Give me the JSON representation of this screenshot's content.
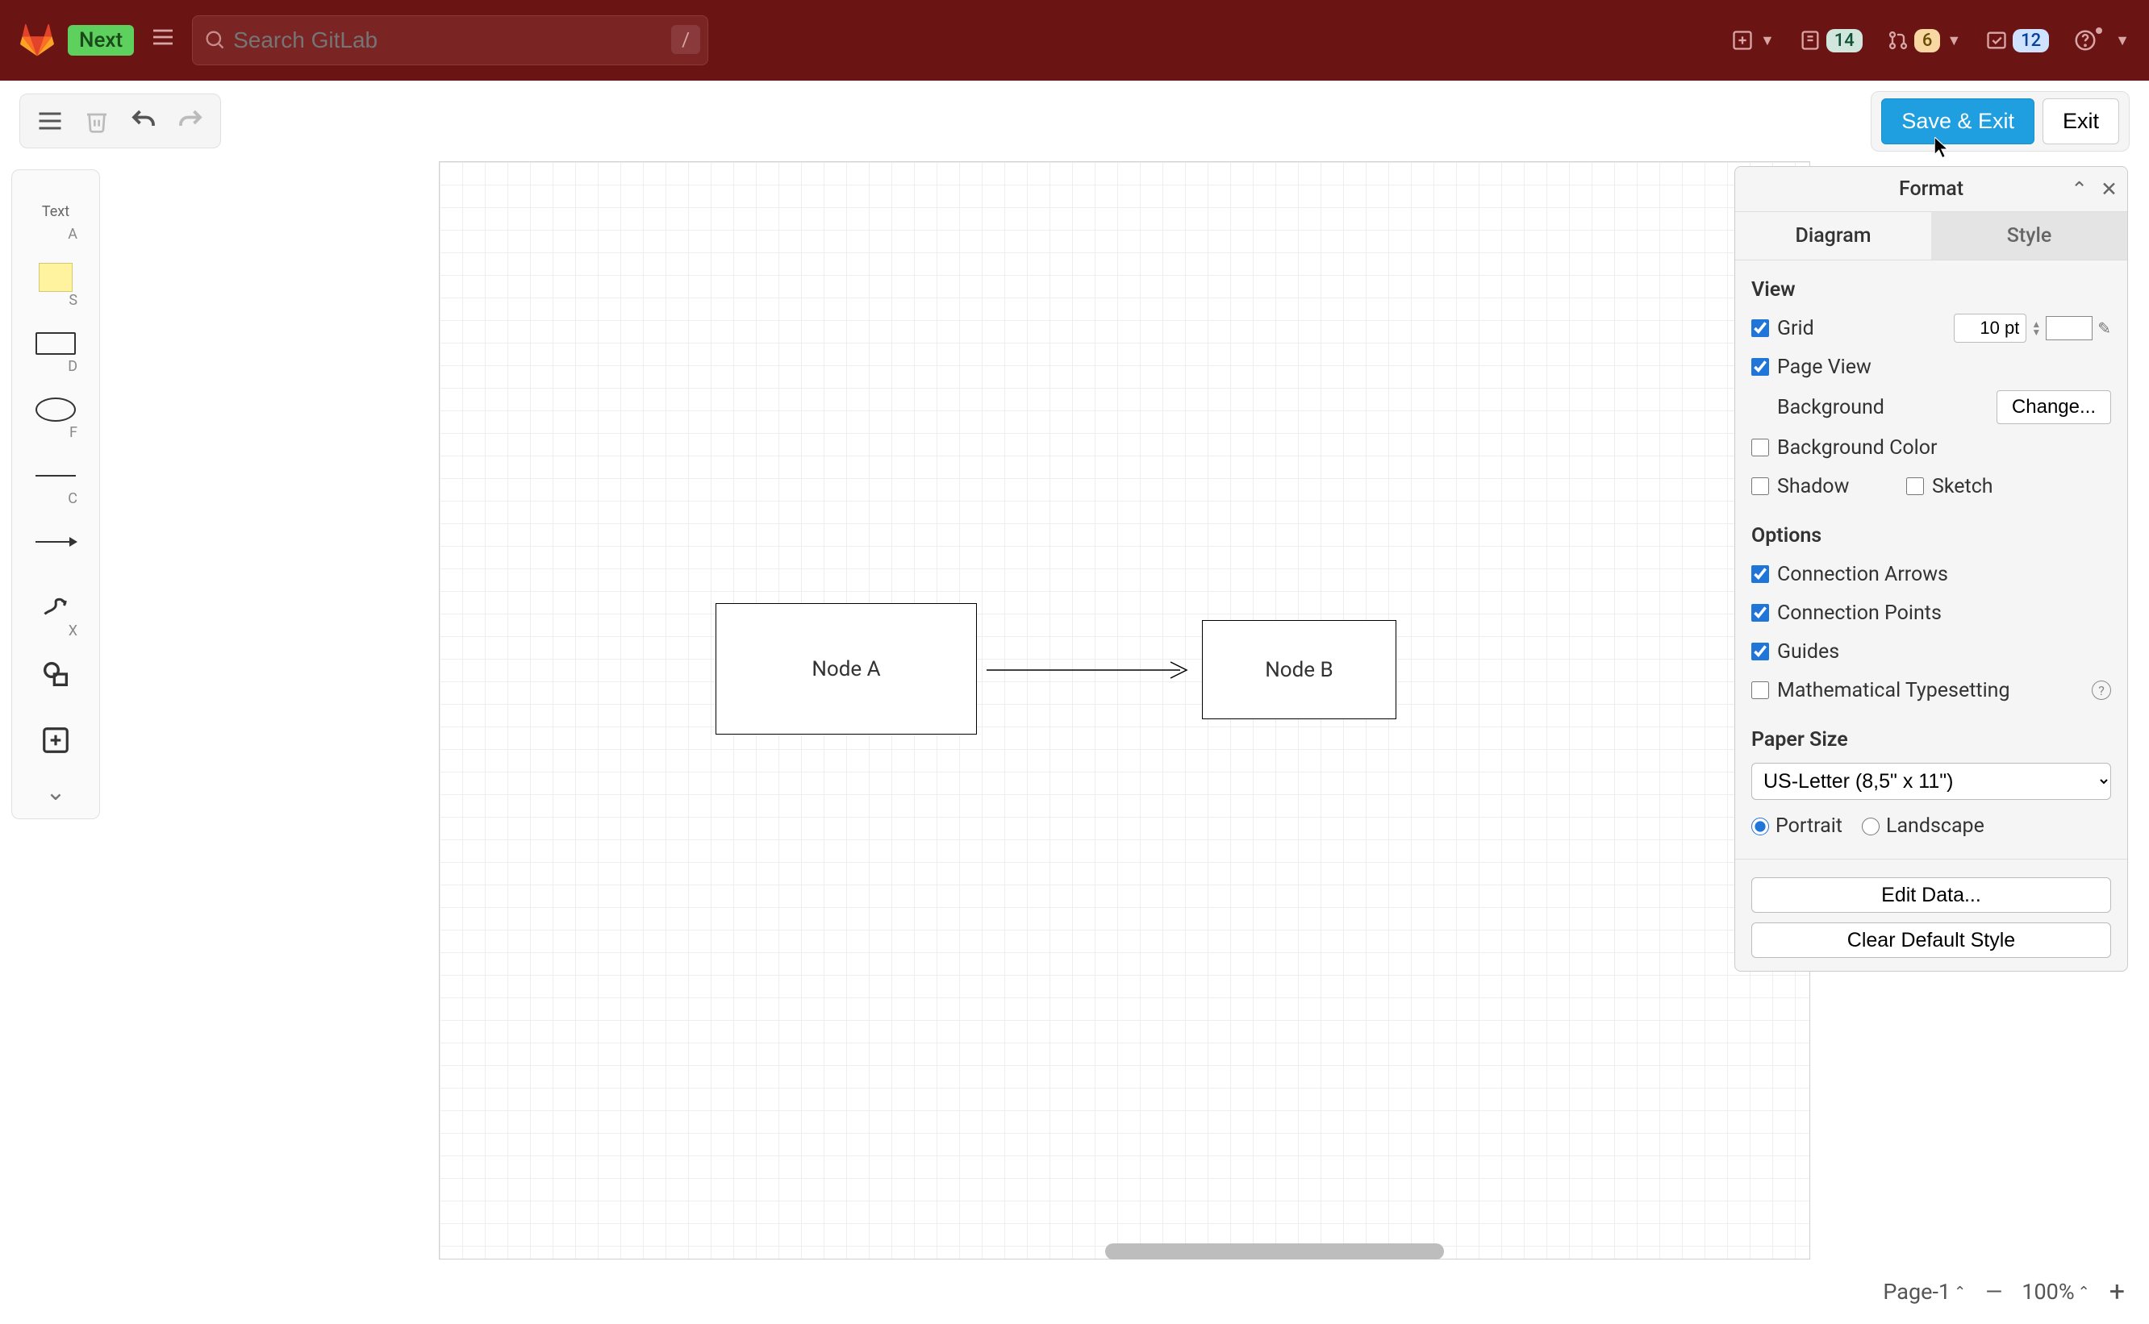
{
  "gitlab": {
    "next_label": "Next",
    "search_placeholder": "Search GitLab",
    "search_shortcut": "/",
    "badges": {
      "issues": "14",
      "merge": "6",
      "todos": "12"
    }
  },
  "toolbar": {
    "save_exit": "Save & Exit",
    "exit": "Exit"
  },
  "palette": {
    "text_label": "Text",
    "key_text": "A",
    "key_note": "S",
    "key_rect": "D",
    "key_ellipse": "F",
    "key_line": "C",
    "key_freehand": "X"
  },
  "diagram": {
    "nodes": {
      "a": {
        "label": "Node A"
      },
      "b": {
        "label": "Node B"
      }
    }
  },
  "format": {
    "title": "Format",
    "tabs": {
      "diagram": "Diagram",
      "style": "Style"
    },
    "view": {
      "title": "View",
      "grid": "Grid",
      "grid_value": "10 pt",
      "page_view": "Page View",
      "background": "Background",
      "change": "Change...",
      "background_color": "Background Color",
      "shadow": "Shadow",
      "sketch": "Sketch"
    },
    "options": {
      "title": "Options",
      "connection_arrows": "Connection Arrows",
      "connection_points": "Connection Points",
      "guides": "Guides",
      "math": "Mathematical Typesetting"
    },
    "paper": {
      "title": "Paper Size",
      "size": "US-Letter (8,5\" x 11\")",
      "portrait": "Portrait",
      "landscape": "Landscape"
    },
    "edit_data": "Edit Data...",
    "clear_style": "Clear Default Style"
  },
  "bottom": {
    "page": "Page-1",
    "zoom": "100%"
  }
}
